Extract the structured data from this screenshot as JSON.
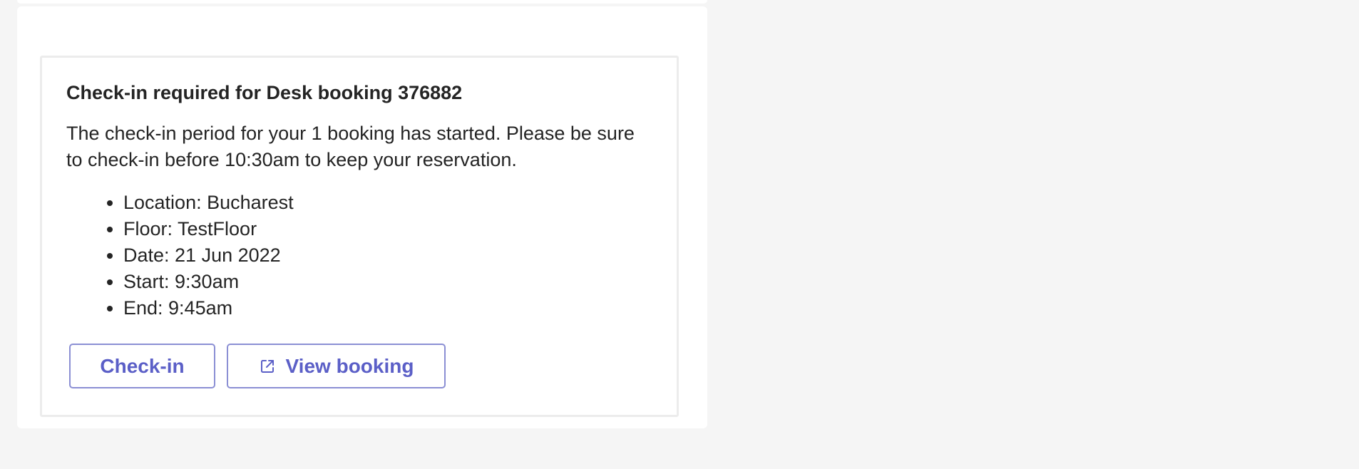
{
  "card": {
    "title": "Check-in required for Desk booking 376882",
    "body": "The check-in period for your 1 booking has started. Please be sure to check-in before 10:30am to keep your reservation.",
    "details": [
      "Location: Bucharest",
      "Floor: TestFloor",
      "Date: 21 Jun 2022",
      "Start: 9:30am",
      "End: 9:45am"
    ],
    "actions": {
      "checkin_label": "Check-in",
      "view_label": "View booking",
      "view_icon": "external-link-icon"
    }
  },
  "colors": {
    "page_background": "#f5f5f5",
    "card_background": "#ffffff",
    "card_border": "#ececec",
    "text": "#242424",
    "accent": "#5b5fc7",
    "button_border": "#8b8fd4"
  }
}
